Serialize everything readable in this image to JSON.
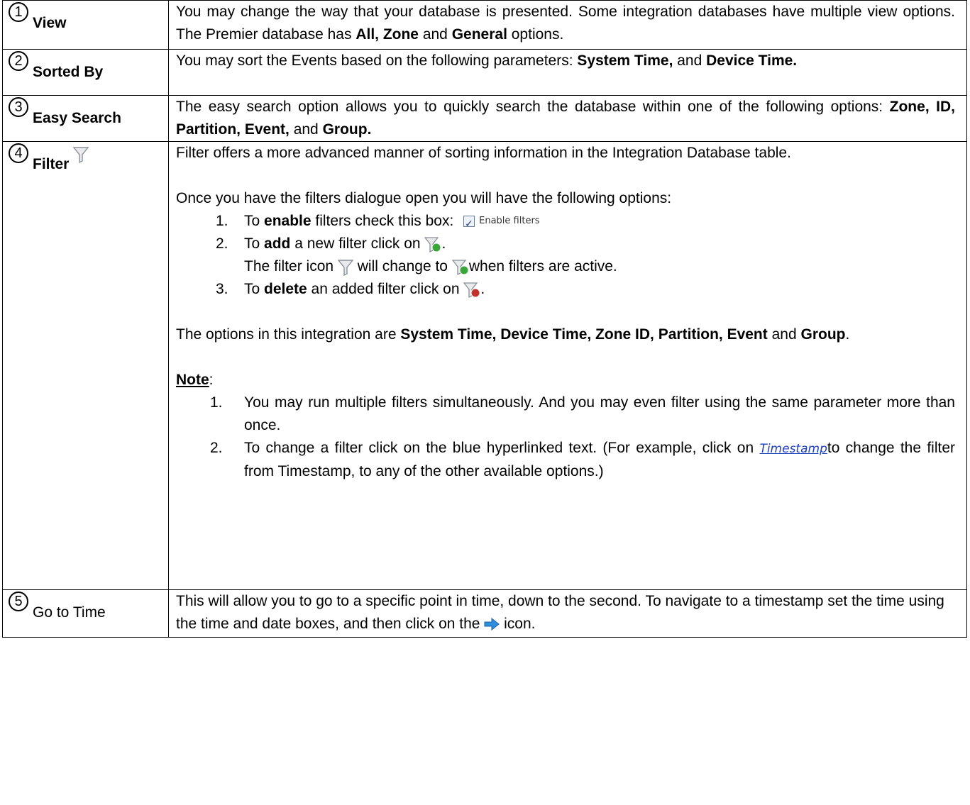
{
  "rows": [
    {
      "num": "1",
      "label": "View",
      "desc_1": "You may change the way that your database is presented. Some integration databases have multiple view options. The Premier database has ",
      "desc_b1": "All, Zone",
      "desc_2": " and ",
      "desc_b2": "General",
      "desc_3": " options."
    },
    {
      "num": "2",
      "label": "Sorted By",
      "desc_1": "You may sort the Events based on the following parameters: ",
      "desc_b1": "System Time,",
      "desc_2": " and ",
      "desc_b2": "Device Time."
    },
    {
      "num": "3",
      "label": "Easy Search",
      "desc_1": "The easy search option allows you to quickly search the database within one of the following options: ",
      "desc_b1": "Zone, ID, Partition, Event,",
      "desc_2": " and ",
      "desc_b2": "Group."
    },
    {
      "num": "4",
      "label": "Filter",
      "intro": "Filter offers a more advanced manner of sorting information in the Integration Database table.",
      "open_text": "Once you have the filters dialogue open you will have the following options:",
      "steps": [
        {
          "n": "1.",
          "a": "To ",
          "b": "enable",
          "c": " filters check this box:",
          "chk_label": "Enable filters"
        },
        {
          "n": "2.",
          "a": "To ",
          "b": "add",
          "c": " a new filter click on",
          "d": ".",
          "sub_a": "The filter icon",
          "sub_b": "will change to",
          "sub_c": "when filters are active."
        },
        {
          "n": "3.",
          "a": "To ",
          "b": "delete",
          "c": " an added filter click on",
          "d": "."
        }
      ],
      "options_1": "The options in this integration are ",
      "options_b1": "System Time, Device Time, Zone ID, Partition, Event",
      "options_2": " and ",
      "options_b2": "Group",
      "options_3": ".",
      "note_label": "Note",
      "note_colon": ":",
      "notes": [
        {
          "n": "1.",
          "text": "You may run multiple filters simultaneously. And you may even filter using the same parameter more than once."
        },
        {
          "n": "2.",
          "a": "To change a filter click on the blue hyperlinked text. (For example, click on ",
          "link": "Timestamp",
          "b": "to change the filter from Timestamp, to any of the other available options.)"
        }
      ]
    },
    {
      "num": "5",
      "label": "Go to Time",
      "desc_1": "This will allow you to go to a specific point in time, down to the second. To navigate to a timestamp set the time using the time and date boxes, and then click on the",
      "desc_2": "icon."
    }
  ],
  "colors": {
    "link": "#1f3fbf",
    "arrow": "#2f8de0",
    "active_dot": "#3aa63a",
    "delete_dot": "#c0322b"
  }
}
